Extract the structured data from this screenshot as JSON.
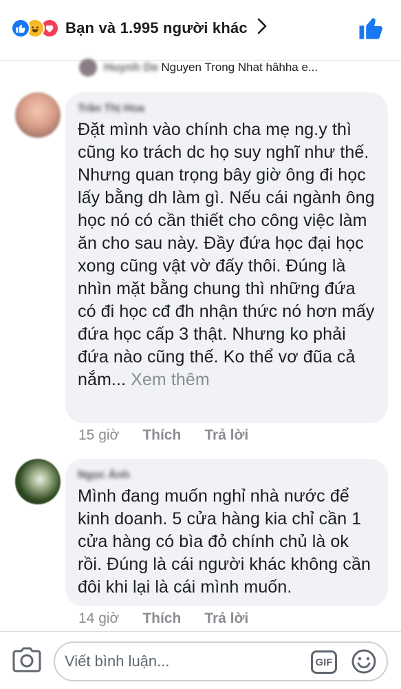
{
  "header": {
    "reaction_summary": "Bạn và 1.995 người khác",
    "reaction_icons": [
      "like-icon",
      "haha-icon",
      "love-icon"
    ]
  },
  "previous_reply": {
    "author_blurred": "Huynh De",
    "text": "Nguyen Trong Nhat hâhha e..."
  },
  "comments": [
    {
      "author_blurred": "Trần Thị Hoa",
      "text": "Đặt mình vào chính cha mẹ ng.y thì cũng ko trách dc họ suy nghĩ như thế. Nhưng quan trọng bây giờ ông đi học lấy bằng dh làm gì. Nếu cái ngành ông học nó có  cần thiết cho công việc làm ăn cho sau này. Đầy đứa học đại học xong cũng vật vờ đấy thôi. Đúng là nhìn mặt bằng chung thì những đứa có đi học cđ đh nhận thức nó hơn mấy đứa học cấp 3 thật. Nhưng ko phải đứa nào cũng thế. Ko thể vơ đũa cả nắm...",
      "see_more": "Xem thêm",
      "time": "15 giờ",
      "like_label": "Thích",
      "reply_label": "Trả lời"
    },
    {
      "author_blurred": "Ngọc Ánh",
      "text": "Mình đang muốn nghỉ nhà nước để kinh doanh. 5 cửa hàng kia chỉ cần 1 cửa hàng có bìa đỏ chính chủ là ok rồi. Đúng là cái người khác không cần đôi khi lại là cái mình muốn.",
      "time": "14 giờ",
      "like_label": "Thích",
      "reply_label": "Trả lời"
    }
  ],
  "composer": {
    "placeholder": "Viết bình luận...",
    "gif_label": "GIF"
  },
  "colors": {
    "facebook_blue": "#1877f2",
    "bubble_bg": "#f0f2f5",
    "muted_text": "#8a8d91"
  }
}
